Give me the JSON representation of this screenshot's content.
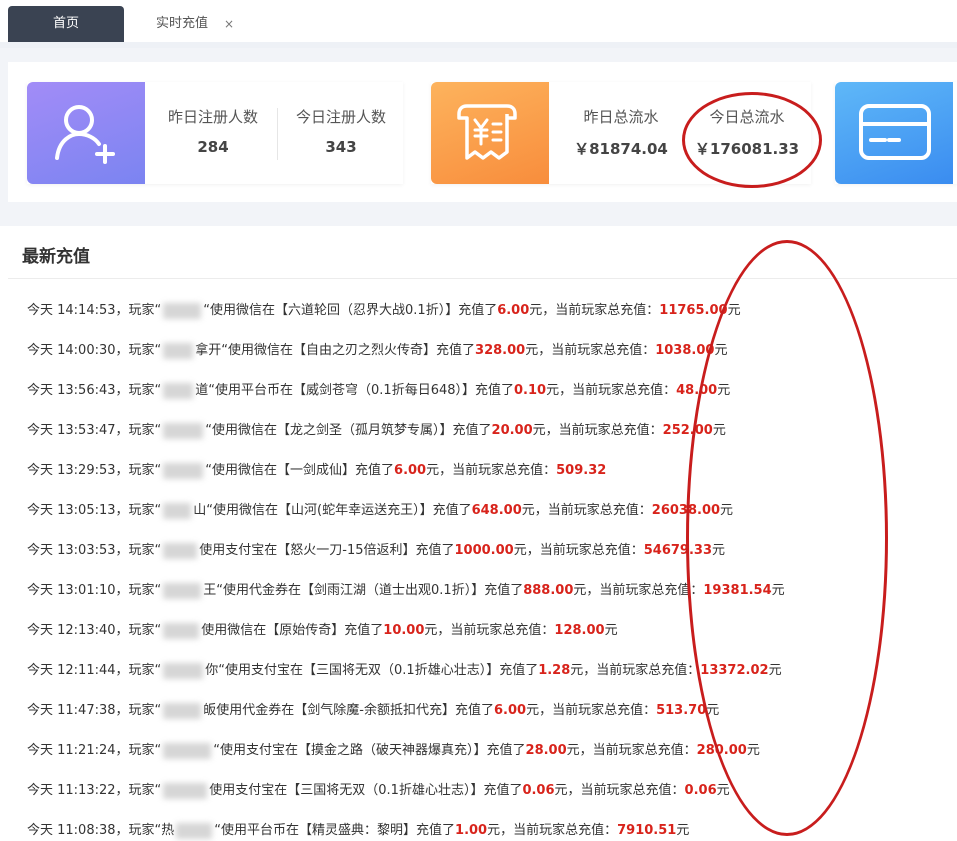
{
  "tabs": {
    "home_label": "首页",
    "recharge_label": "实时充值",
    "close_glyph": "×"
  },
  "stats": {
    "yesterday_registered_label": "昨日注册人数",
    "yesterday_registered_value": "284",
    "today_registered_label": "今日注册人数",
    "today_registered_value": "343",
    "yesterday_revenue_label": "昨日总流水",
    "yesterday_revenue_value": "￥81874.04",
    "today_revenue_label": "今日总流水",
    "today_revenue_value": "￥176081.33"
  },
  "panel": {
    "title": "最新充值"
  },
  "records": [
    {
      "time": "今天 14:14:53，玩家“",
      "name_tail": "“",
      "method": "使用微信在【六道轮回（忍界大战0.1折）】充值了",
      "amount": "6.00",
      "mid": "元，当前玩家总充值：",
      "total": "11765.00",
      "end": "元"
    },
    {
      "time": "今天 14:00:30，玩家“",
      "name_tail": "拿开“",
      "method": "使用微信在【自由之刃之烈火传奇】充值了",
      "amount": "328.00",
      "mid": "元，当前玩家总充值：",
      "total": "1038.00",
      "end": "元"
    },
    {
      "time": "今天 13:56:43，玩家“",
      "name_tail": "道“",
      "method": "使用平台币在【威剑苍穹（0.1折每日648）】充值了",
      "amount": "0.10",
      "mid": "元，当前玩家总充值：",
      "total": "48.00",
      "end": "元"
    },
    {
      "time": "今天 13:53:47，玩家“",
      "name_tail": "“",
      "method": "使用微信在【龙之剑圣（孤月筑梦专属）】充值了",
      "amount": "20.00",
      "mid": "元，当前玩家总充值：",
      "total": "252.00",
      "end": "元"
    },
    {
      "time": "今天 13:29:53，玩家“",
      "name_tail": "“",
      "method": "使用微信在【一剑成仙】充值了",
      "amount": "6.00",
      "mid": "元，当前玩家总充值：",
      "total": "509.32",
      "end": ""
    },
    {
      "time": "今天 13:05:13，玩家“",
      "name_tail": "山“",
      "method": "使用微信在【山河(蛇年幸运送充王）】充值了",
      "amount": "648.00",
      "mid": "元，当前玩家总充值：",
      "total": "26038.00",
      "end": "元"
    },
    {
      "time": "今天 13:03:53，玩家“",
      "name_tail": "",
      "method": "使用支付宝在【怒火一刀-15倍返利】充值了",
      "amount": "1000.00",
      "mid": "元，当前玩家总充值：",
      "total": "54679.33",
      "end": "元"
    },
    {
      "time": "今天 13:01:10，玩家“",
      "name_tail": "王“",
      "method": "使用代金券在【剑雨江湖（道士出观0.1折）】充值了",
      "amount": "888.00",
      "mid": "元，当前玩家总充值：",
      "total": "19381.54",
      "end": "元"
    },
    {
      "time": "今天 12:13:40，玩家“",
      "name_tail": "",
      "method": "使用微信在【原始传奇】充值了",
      "amount": "10.00",
      "mid": "元，当前玩家总充值：",
      "total": "128.00",
      "end": "元"
    },
    {
      "time": "今天 12:11:44，玩家“",
      "name_tail": "你“",
      "method": "使用支付宝在【三国将无双（0.1折雄心壮志）】充值了",
      "amount": "1.28",
      "mid": "元，当前玩家总充值：",
      "total": "13372.02",
      "end": "元"
    },
    {
      "time": "今天 11:47:38，玩家“",
      "name_tail": "皈",
      "method": "使用代金券在【剑气除魔-余额抵扣代充】充值了",
      "amount": "6.00",
      "mid": "元，当前玩家总充值：",
      "total": "513.70",
      "end": "元"
    },
    {
      "time": "今天 11:21:24，玩家“",
      "name_tail": "“",
      "method": "使用支付宝在【摸金之路（破天神器爆真充）】充值了",
      "amount": "28.00",
      "mid": "元，当前玩家总充值：",
      "total": "280.00",
      "end": "元"
    },
    {
      "time": "今天 11:13:22，玩家“",
      "name_tail": "",
      "method": "使用支付宝在【三国将无双（0.1折雄心壮志）】充值了",
      "amount": "0.06",
      "mid": "元，当前玩家总充值：",
      "total": "0.06",
      "end": "元"
    },
    {
      "time": "今天 11:08:38，玩家“热",
      "name_tail": "“",
      "method": "使用平台币在【精灵盛典：黎明】充值了",
      "amount": "1.00",
      "mid": "元，当前玩家总充值：",
      "total": "7910.51",
      "end": "元"
    }
  ],
  "colors": {
    "tab_active_bg": "#3a4352",
    "amount_red": "#d8231b",
    "annotation_red": "#c81d1d"
  }
}
